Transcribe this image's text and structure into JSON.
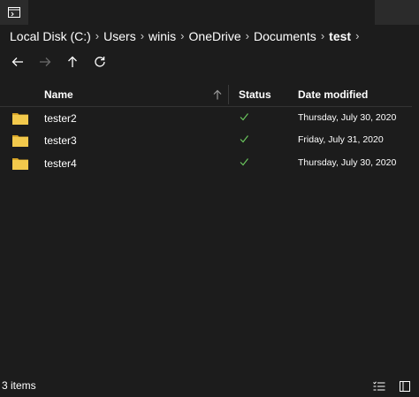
{
  "breadcrumb": [
    "Local Disk (C:)",
    "Users",
    "winis",
    "OneDrive",
    "Documents",
    "test"
  ],
  "columns": {
    "name": "Name",
    "status": "Status",
    "date": "Date modified"
  },
  "files": [
    {
      "name": "tester2",
      "status": "synced-check",
      "date": "Thursday, July 30, 2020"
    },
    {
      "name": "tester3",
      "status": "synced-check",
      "date": "Friday, July 31, 2020"
    },
    {
      "name": "tester4",
      "status": "synced-check",
      "date": "Thursday, July 30, 2020"
    }
  ],
  "status_bar": {
    "count": "3 items"
  },
  "colors": {
    "background": "#1c1c1c",
    "folder": "#f2c94c",
    "check": "#6ccb5f"
  }
}
